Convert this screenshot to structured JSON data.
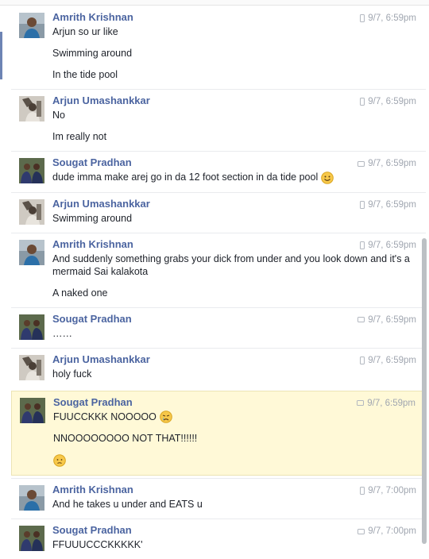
{
  "messages": [
    {
      "sender": "Amrith Krishnan",
      "avatar": "avatar-amrith",
      "time": "9/7, 6:59pm",
      "source": "mobile",
      "lines": [
        "Arjun so ur like",
        "Swimming around",
        "In the tide pool"
      ]
    },
    {
      "sender": "Arjun Umashankkar",
      "avatar": "avatar-arjun",
      "time": "9/7, 6:59pm",
      "source": "mobile",
      "lines": [
        "No",
        "Im really not"
      ]
    },
    {
      "sender": "Sougat Pradhan",
      "avatar": "avatar-sougat",
      "time": "9/7, 6:59pm",
      "source": "web",
      "lines": [
        "dude imma make arej go in da 12 foot section in da tide pool"
      ],
      "emoji_after": [
        "smile"
      ]
    },
    {
      "sender": "Arjun Umashankkar",
      "avatar": "avatar-arjun",
      "time": "9/7, 6:59pm",
      "source": "mobile",
      "lines": [
        "Swimming around"
      ]
    },
    {
      "sender": "Amrith Krishnan",
      "avatar": "avatar-amrith",
      "time": "9/7, 6:59pm",
      "source": "mobile",
      "lines": [
        "And suddenly something grabs your dick from under and you look down and it's a mermaid Sai kalakota",
        "A naked one"
      ]
    },
    {
      "sender": "Sougat Pradhan",
      "avatar": "avatar-sougat",
      "time": "9/7, 6:59pm",
      "source": "web",
      "lines": [
        "……"
      ]
    },
    {
      "sender": "Arjun Umashankkar",
      "avatar": "avatar-arjun",
      "time": "9/7, 6:59pm",
      "source": "mobile",
      "lines": [
        "holy fuck"
      ]
    },
    {
      "sender": "Sougat Pradhan",
      "avatar": "avatar-sougat",
      "time": "9/7, 6:59pm",
      "source": "web",
      "highlighted": true,
      "lines": [
        "FUUCCKKK NOOOOO",
        "NNOOOOOOOO NOT THAT!!!!!!",
        ""
      ],
      "emoji_after": [
        "crying",
        "",
        "worried"
      ]
    },
    {
      "sender": "Amrith Krishnan",
      "avatar": "avatar-amrith",
      "time": "9/7, 7:00pm",
      "source": "mobile",
      "lines": [
        "And he takes u under and EATS u"
      ]
    },
    {
      "sender": "Sougat Pradhan",
      "avatar": "avatar-sougat",
      "time": "9/7, 7:00pm",
      "source": "web",
      "lines": [
        "FFUUUCCCKKKKK'"
      ]
    }
  ],
  "colors": {
    "name": "#4b64a0",
    "time": "#a0a6b0",
    "highlight_bg": "#fff9d7",
    "divider": "#e9ebee"
  }
}
